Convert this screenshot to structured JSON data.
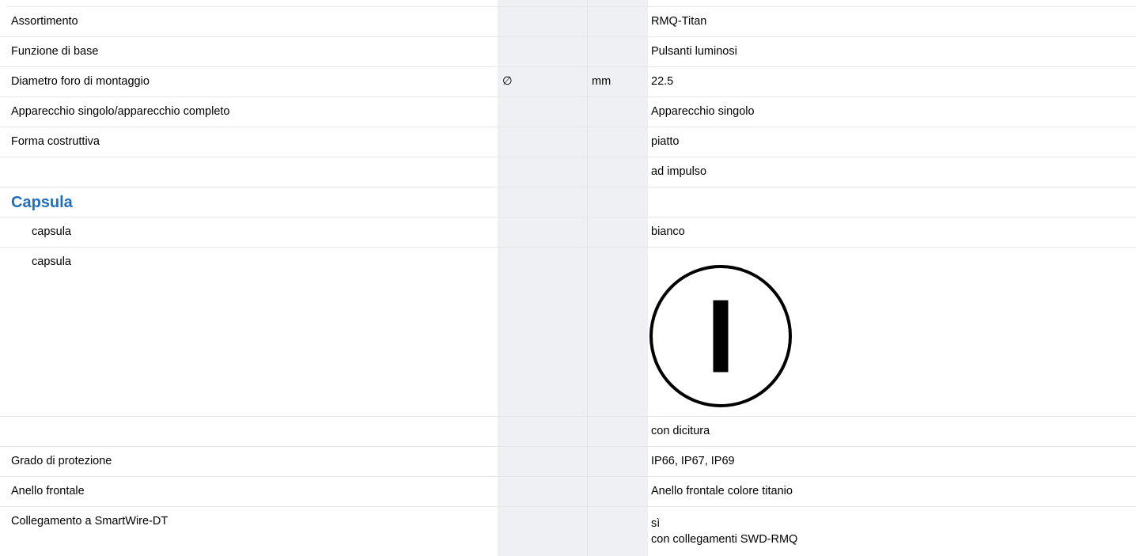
{
  "colors": {
    "accent": "#1f6fbf",
    "grey_column": "#eff0f3",
    "row_rule": "#e6e6e6",
    "text": "#000000"
  },
  "rows": [
    {
      "label": "Assortimento",
      "value": "RMQ-Titan"
    },
    {
      "label": "Funzione di base",
      "value": "Pulsanti luminosi"
    },
    {
      "label": "Diametro foro di montaggio",
      "symbol": "∅",
      "unit": "mm",
      "value": "22.5"
    },
    {
      "label": "Apparecchio singolo/apparecchio completo",
      "value": "Apparecchio singolo"
    },
    {
      "label": "Forma costruttiva",
      "value": "piatto"
    },
    {
      "label": "",
      "value": "ad impulso"
    }
  ],
  "capsula_section": {
    "title": "Capsula",
    "rows": [
      {
        "label": "capsula",
        "value": "bianco"
      },
      {
        "label": "capsula",
        "image": "power-on-symbol-icon",
        "image_glyph": "I"
      }
    ]
  },
  "rows_after": [
    {
      "label": "",
      "value": "con dicitura"
    },
    {
      "label": "Grado di protezione",
      "value": "IP66, IP67, IP69"
    },
    {
      "label": "Anello frontale",
      "value": "Anello frontale colore titanio"
    },
    {
      "label": "Collegamento a SmartWire-DT",
      "value_lines": [
        "sì",
        "con collegamenti SWD-RMQ"
      ]
    }
  ]
}
